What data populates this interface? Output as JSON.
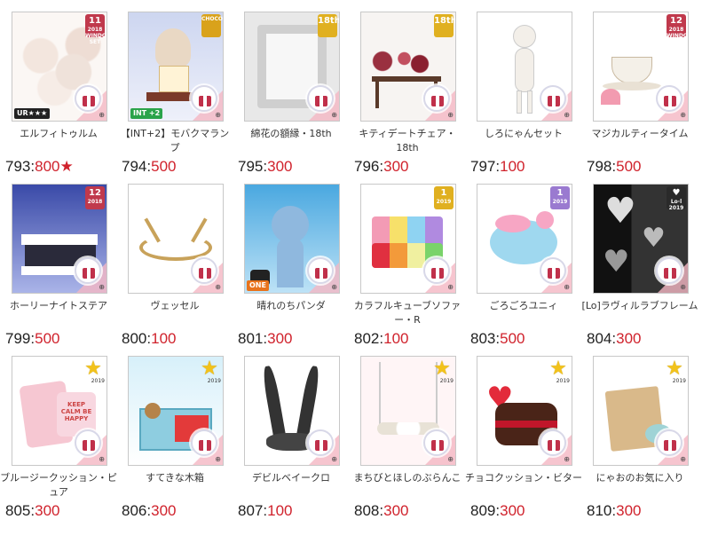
{
  "colors": {
    "accent": "#d0222c",
    "gift": "#c0304a",
    "star": "#f2c21b"
  },
  "items": [
    {
      "name": "エルフィトゥルム",
      "id": "793",
      "price": "800",
      "suffix": "★",
      "badge": {
        "type": "box",
        "num": "11",
        "sub": "2018 WINDOW SET",
        "color": "#c0394c"
      },
      "tag": "UR★★★",
      "art": "fluffy"
    },
    {
      "name": "【INT+2】モバクマランプ",
      "id": "794",
      "price": "500",
      "suffix": "",
      "badge": {
        "type": "box",
        "num": "",
        "sub": "CHOCO",
        "color": "#d9a21b"
      },
      "tag": "INT +2",
      "art": "lamp"
    },
    {
      "name": "綿花の額縁・18th",
      "id": "795",
      "price": "300",
      "suffix": "",
      "badge": {
        "type": "box",
        "num": "18th",
        "sub": "",
        "color": "#e0b020"
      },
      "tag": "",
      "art": "frame"
    },
    {
      "name": "キティデートチェア・18th",
      "id": "796",
      "price": "300",
      "suffix": "",
      "badge": {
        "type": "box",
        "num": "18th",
        "sub": "",
        "color": "#e0b020"
      },
      "tag": "",
      "art": "chair"
    },
    {
      "name": "しろにゃんセット",
      "id": "797",
      "price": "100",
      "suffix": "",
      "badge": null,
      "tag": "",
      "art": "doll"
    },
    {
      "name": "マジカルティータイム",
      "id": "798",
      "price": "500",
      "suffix": "",
      "badge": {
        "type": "box",
        "num": "12",
        "sub": "2018 WINDOW",
        "color": "#c0394c"
      },
      "tag": "",
      "art": "tea"
    },
    {
      "name": "ホーリーナイトステア",
      "id": "799",
      "price": "500",
      "suffix": "",
      "badge": {
        "type": "box",
        "num": "12",
        "sub": "2018",
        "color": "#c0394c"
      },
      "tag": "",
      "art": "stairs"
    },
    {
      "name": "ヴェッセル",
      "id": "800",
      "price": "100",
      "suffix": "",
      "badge": null,
      "tag": "",
      "art": "vessel"
    },
    {
      "name": "晴れのちパンダ",
      "id": "801",
      "price": "300",
      "suffix": "",
      "badge": null,
      "tag": "ONE",
      "art": "panda"
    },
    {
      "name": "カラフルキューブソファー・R",
      "id": "802",
      "price": "100",
      "suffix": "",
      "badge": {
        "type": "box",
        "num": "1",
        "sub": "2019",
        "color": "#e0b020"
      },
      "tag": "",
      "art": "cubes"
    },
    {
      "name": "ごろごろユニィ",
      "id": "803",
      "price": "500",
      "suffix": "",
      "badge": {
        "type": "box",
        "num": "1",
        "sub": "2019",
        "color": "#9a7ad0"
      },
      "tag": "",
      "art": "unicorn"
    },
    {
      "name": "[Lo]ラヴィルラブフレーム",
      "id": "804",
      "price": "300",
      "suffix": "",
      "badge": {
        "type": "box",
        "num": "♥",
        "sub": "Lo·l 2019",
        "color": "#2a2a2a"
      },
      "tag": "",
      "art": "hearts"
    },
    {
      "name": "ブルージークッション・ピュア",
      "id": "805",
      "price": "300",
      "suffix": "",
      "badge": {
        "type": "star",
        "sub": "2019"
      },
      "tag": "",
      "art": "cushion"
    },
    {
      "name": "すてきな木箱",
      "id": "806",
      "price": "300",
      "suffix": "",
      "badge": {
        "type": "star",
        "sub": "2019"
      },
      "tag": "",
      "art": "box"
    },
    {
      "name": "デビルベイークロ",
      "id": "807",
      "price": "100",
      "suffix": "",
      "badge": null,
      "tag": "",
      "art": "claw"
    },
    {
      "name": "まちびとほしのぶらんこ",
      "id": "808",
      "price": "300",
      "suffix": "",
      "badge": {
        "type": "star",
        "sub": "2019"
      },
      "tag": "",
      "art": "swing"
    },
    {
      "name": "チョコクッション・ビター",
      "id": "809",
      "price": "300",
      "suffix": "",
      "badge": {
        "type": "star",
        "sub": "2019"
      },
      "tag": "",
      "art": "choco"
    },
    {
      "name": "にゃおのお気に入り",
      "id": "810",
      "price": "300",
      "suffix": "",
      "badge": {
        "type": "star",
        "sub": "2019"
      },
      "tag": "",
      "art": "bag"
    }
  ]
}
